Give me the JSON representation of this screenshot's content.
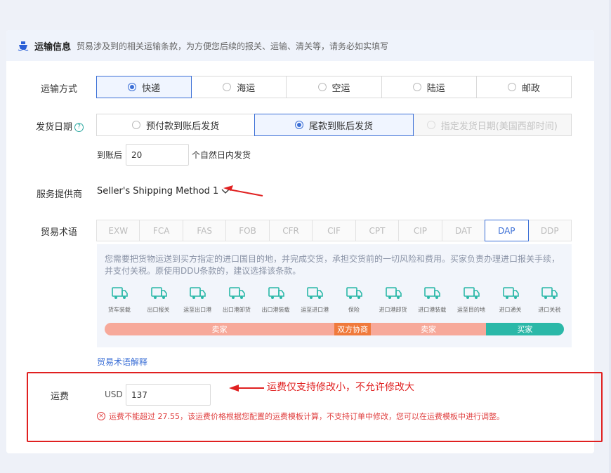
{
  "header": {
    "title": "运输信息",
    "desc": "贸易涉及到的相关运输条款，为方便您后续的报关、运输、清关等，请务必如实填写"
  },
  "transport": {
    "label": "运输方式",
    "options": [
      "快递",
      "海运",
      "空运",
      "陆运",
      "邮政"
    ],
    "selected": "快递"
  },
  "ship_date": {
    "label": "发货日期",
    "help": "?",
    "options": [
      "预付款到账后发货",
      "尾款到账后发货",
      "指定发货日期(美国西部时间)"
    ],
    "selected": "尾款到账后发货",
    "disabled": "指定发货日期(美国西部时间)",
    "days_prefix": "到账后",
    "days_value": "20",
    "days_suffix": "个自然日内发货"
  },
  "provider": {
    "label": "服务提供商",
    "value": "Seller's Shipping Method 1"
  },
  "trade_terms": {
    "label": "贸易术语",
    "options": [
      "EXW",
      "FCA",
      "FAS",
      "FOB",
      "CFR",
      "CIF",
      "CPT",
      "CIP",
      "DAT",
      "DAP",
      "DDP"
    ],
    "selected": "DAP",
    "description": "您需要把货物运送到买方指定的进口国目的地，并完成交货，承担交货前的一切风险和费用。买家负责办理进口报关手续，并支付关税。原使用DDU条款的，建议选择该条款。",
    "steps": [
      "货车装载",
      "出口报关",
      "运至出口港",
      "出口港卸货",
      "出口港装载",
      "运至进口港",
      "保险",
      "进口港卸货",
      "进口港装载",
      "运至目的地",
      "进口通关",
      "进口关税"
    ],
    "bar": [
      {
        "label": "卖家",
        "share": 0.5,
        "color": "#f7a99a"
      },
      {
        "label": "双方协商",
        "share": 0.08,
        "color": "#f07a3c"
      },
      {
        "label": "卖家",
        "share": 0.25,
        "color": "#f7a99a"
      },
      {
        "label": "买家",
        "share": 0.17,
        "color": "#2bb8a8"
      }
    ],
    "explain_link": "贸易术语解释"
  },
  "freight": {
    "label": "运费",
    "currency": "USD",
    "value": "137",
    "error": "运费不能超过 27.55，该运费价格根据您配置的运费模板计算，不支持订单中修改，您可以在运费模板中进行调整。"
  },
  "annotation": "运费仅支持修改小，不允许修改大"
}
